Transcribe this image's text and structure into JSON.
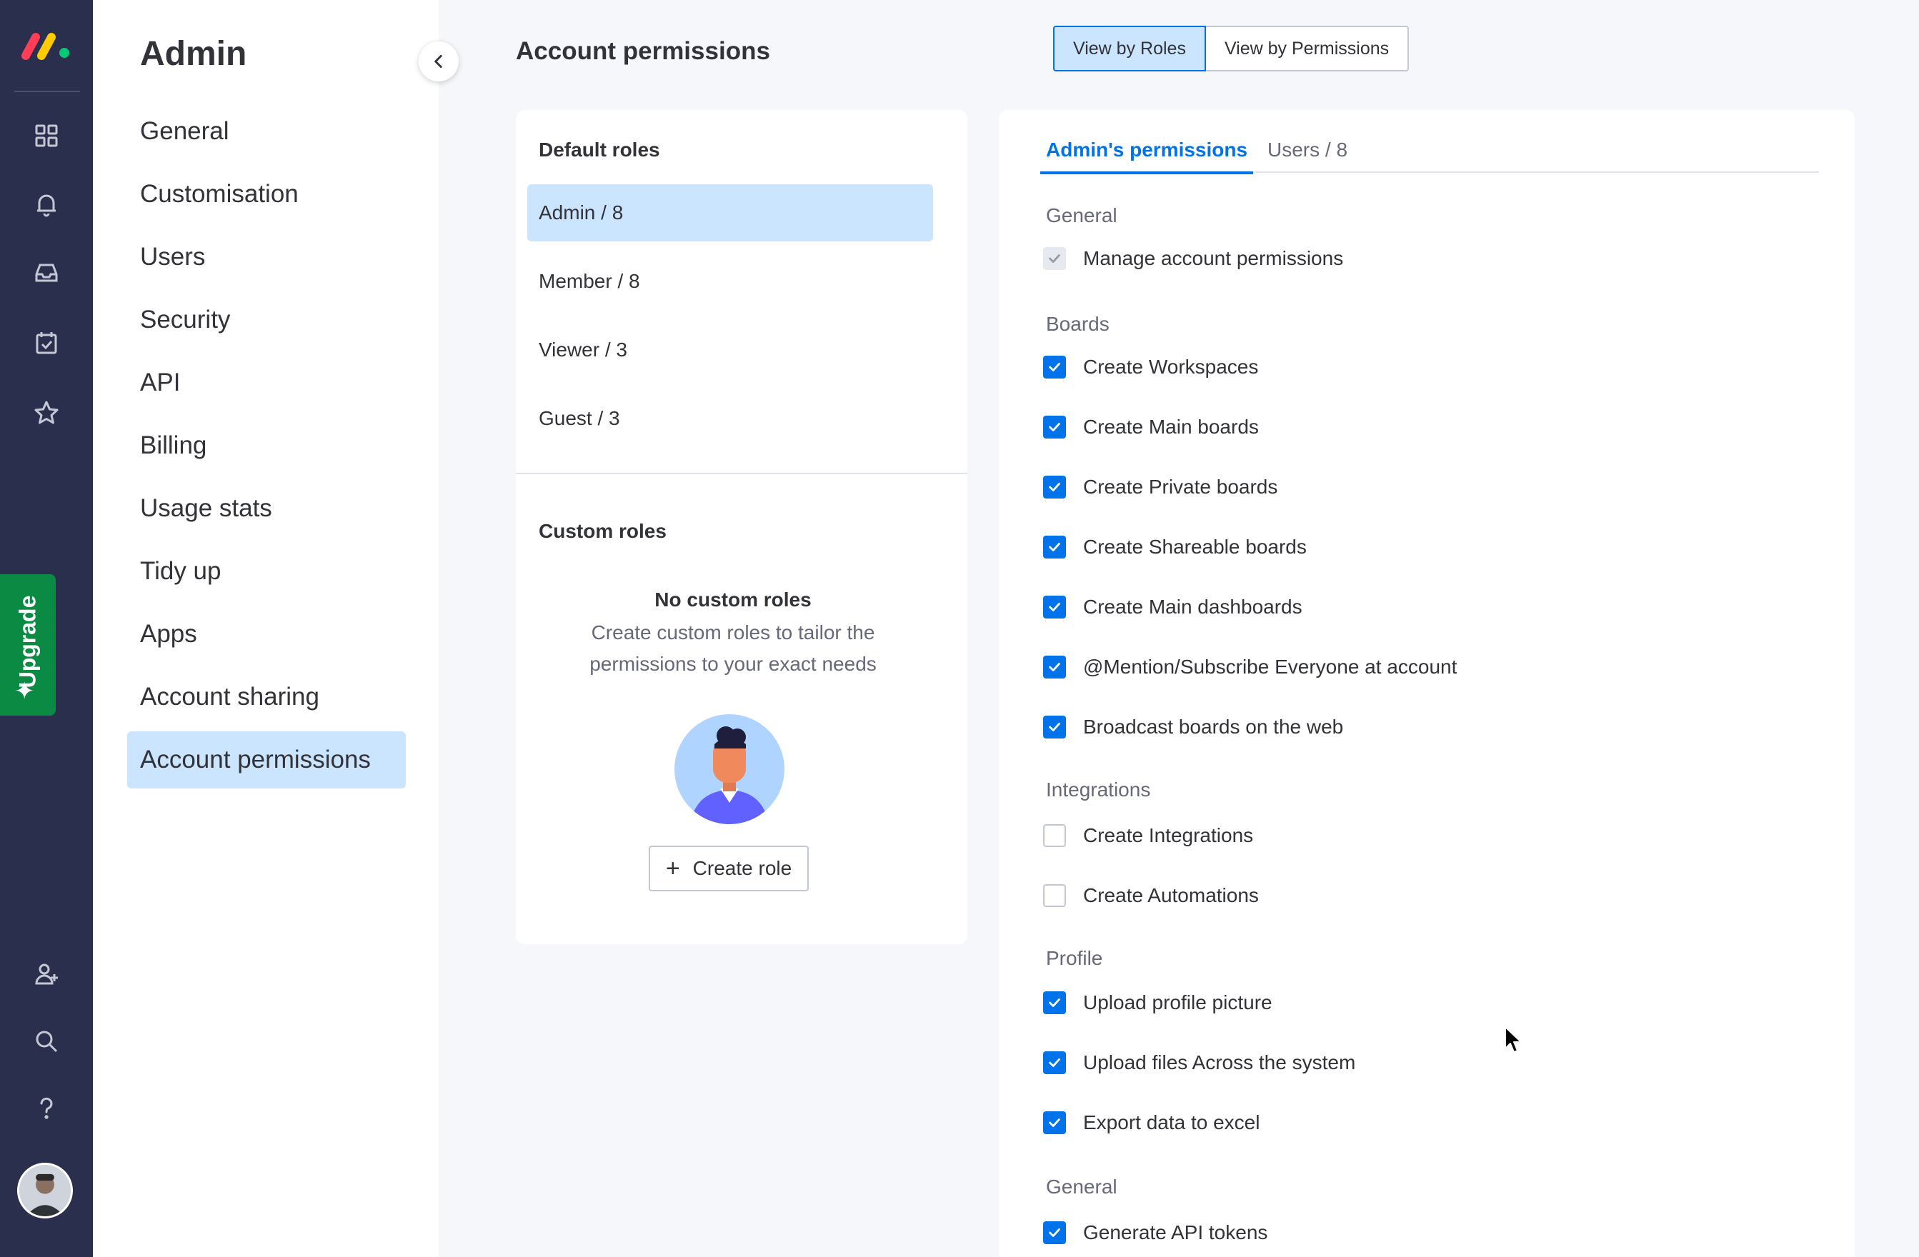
{
  "rail": {
    "icons": [
      "logo",
      "grid-icon",
      "bell-icon",
      "inbox-icon",
      "calendar-check-icon",
      "star-icon",
      "invite-user-icon",
      "search-icon",
      "help-icon"
    ],
    "upgrade_label": "Upgrade",
    "colors": {
      "background": "#292f4c",
      "upgrade": "#0b8a43"
    }
  },
  "sidebar": {
    "title": "Admin",
    "items": [
      {
        "label": "General"
      },
      {
        "label": "Customisation"
      },
      {
        "label": "Users"
      },
      {
        "label": "Security"
      },
      {
        "label": "API"
      },
      {
        "label": "Billing"
      },
      {
        "label": "Usage stats"
      },
      {
        "label": "Tidy up"
      },
      {
        "label": "Apps"
      },
      {
        "label": "Account sharing"
      },
      {
        "label": "Account permissions",
        "active": true
      }
    ]
  },
  "header": {
    "title": "Account permissions",
    "view_by_roles": "View by Roles",
    "view_by_permissions": "View by Permissions",
    "active_view": "View by Roles"
  },
  "roles": {
    "default_heading": "Default roles",
    "default_roles": [
      {
        "label": "Admin / 8",
        "active": true
      },
      {
        "label": "Member / 8"
      },
      {
        "label": "Viewer / 3"
      },
      {
        "label": "Guest / 3"
      }
    ],
    "custom_heading": "Custom roles",
    "empty_title": "No custom roles",
    "empty_description": "Create custom roles to tailor the permissions to your exact needs",
    "create_button": "Create role"
  },
  "permissions": {
    "tabs": [
      {
        "label": "Admin's permissions",
        "active": true
      },
      {
        "label": "Users / 8"
      }
    ],
    "sections": [
      {
        "label": "General",
        "items": [
          {
            "label": "Manage account permissions",
            "checked": true,
            "disabled": true
          }
        ]
      },
      {
        "label": "Boards",
        "items": [
          {
            "label": "Create Workspaces",
            "checked": true
          },
          {
            "label": "Create Main boards",
            "checked": true
          },
          {
            "label": "Create Private boards",
            "checked": true
          },
          {
            "label": "Create Shareable boards",
            "checked": true
          },
          {
            "label": "Create Main dashboards",
            "checked": true
          },
          {
            "label": "@Mention/Subscribe Everyone at account",
            "checked": true
          },
          {
            "label": "Broadcast boards on the web",
            "checked": true
          }
        ]
      },
      {
        "label": "Integrations",
        "items": [
          {
            "label": "Create Integrations",
            "checked": false
          },
          {
            "label": "Create Automations",
            "checked": false
          }
        ]
      },
      {
        "label": "Profile",
        "items": [
          {
            "label": "Upload profile picture",
            "checked": true
          },
          {
            "label": "Upload files Across the system",
            "checked": true
          },
          {
            "label": "Export data to excel",
            "checked": true
          }
        ]
      },
      {
        "label": "General",
        "items": [
          {
            "label": "Generate API tokens",
            "checked": true
          }
        ]
      }
    ]
  },
  "colors": {
    "accent": "#0073ea",
    "selected_bg": "#cce5ff"
  }
}
